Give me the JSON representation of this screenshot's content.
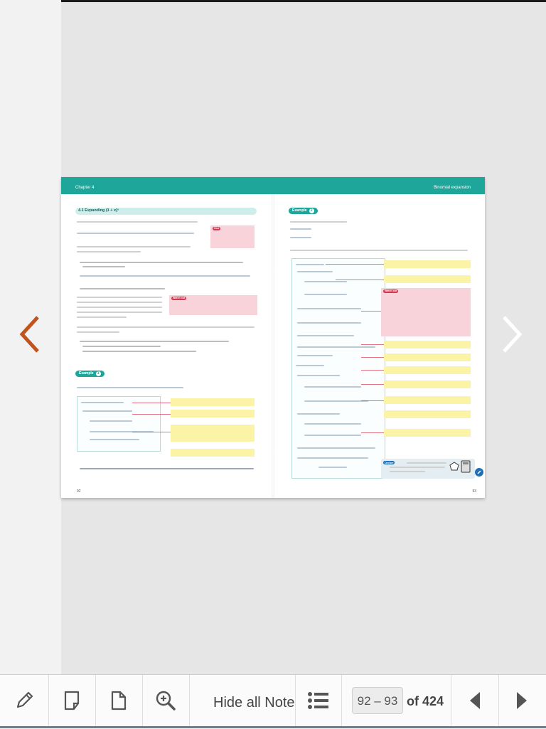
{
  "book": {
    "chapter_label": "Chapter 4",
    "chapter_title": "Binomial expansion",
    "left_page": {
      "section_title": "4.1 Expanding (1 + x)ⁿ",
      "page_number": "92",
      "hint_label": "Hint",
      "watch_out_label": "Watch out",
      "example_label": "Example",
      "example_number": "1"
    },
    "right_page": {
      "example_label": "Example",
      "example_number": "2",
      "watch_out_label": "Watch out",
      "online_label": "Online",
      "page_number": "93"
    }
  },
  "toolbar": {
    "hide_notes_label": "Hide all Notes",
    "page_range": "92 – 93",
    "page_total": "of 424"
  },
  "colors": {
    "brand_teal": "#1ea69b",
    "accent_orange": "#c1531d",
    "note_yellow": "#fbf3a6",
    "note_pink": "#f9d3da"
  },
  "icons": [
    "chevron-left-icon",
    "chevron-right-icon",
    "pencil-icon",
    "sticky-note-icon",
    "page-icon",
    "zoom-in-icon",
    "list-icon",
    "triangle-left-icon",
    "triangle-right-icon"
  ]
}
